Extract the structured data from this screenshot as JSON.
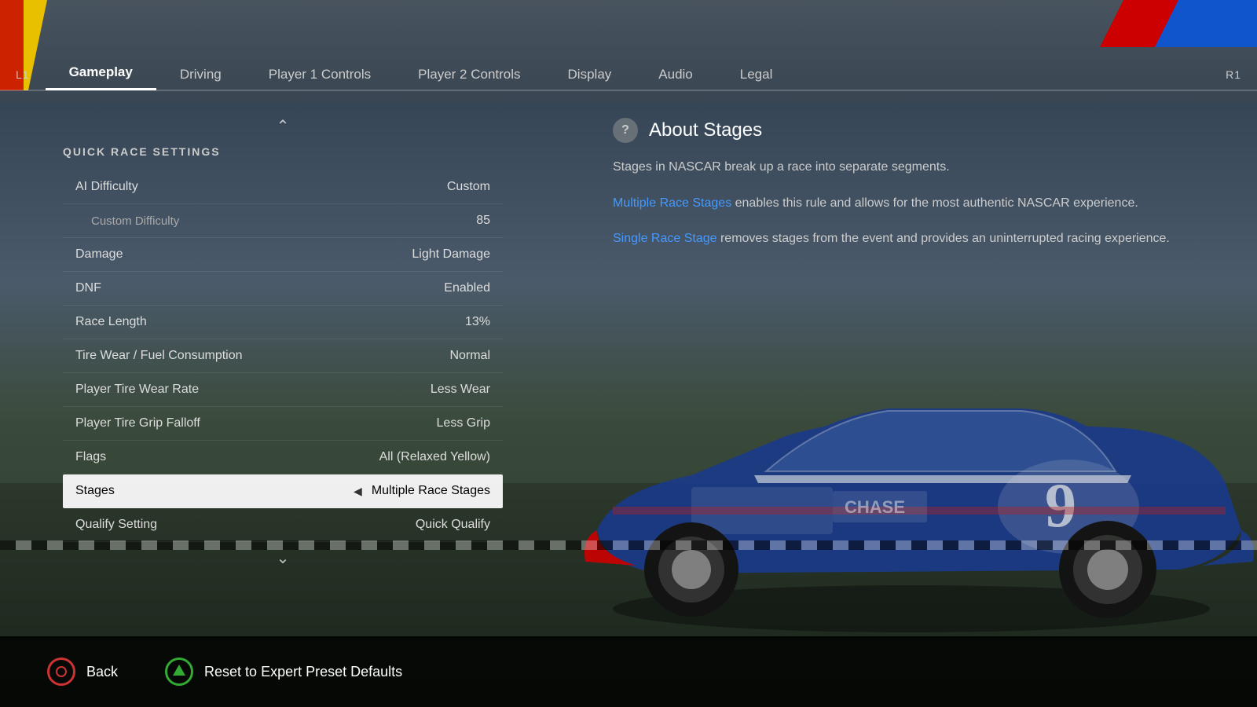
{
  "tabs": {
    "l1": "L1",
    "r1": "R1",
    "items": [
      {
        "label": "Gameplay",
        "active": true
      },
      {
        "label": "Driving",
        "active": false
      },
      {
        "label": "Player 1 Controls",
        "active": false
      },
      {
        "label": "Player 2 Controls",
        "active": false
      },
      {
        "label": "Display",
        "active": false
      },
      {
        "label": "Audio",
        "active": false
      },
      {
        "label": "Legal",
        "active": false
      }
    ]
  },
  "settings": {
    "section_title": "QUICK RACE SETTINGS",
    "rows": [
      {
        "name": "AI Difficulty",
        "value": "Custom",
        "indented": false,
        "active": false
      },
      {
        "name": "Custom Difficulty",
        "value": "85",
        "indented": true,
        "active": false
      },
      {
        "name": "Damage",
        "value": "Light Damage",
        "indented": false,
        "active": false
      },
      {
        "name": "DNF",
        "value": "Enabled",
        "indented": false,
        "active": false
      },
      {
        "name": "Race Length",
        "value": "13%",
        "indented": false,
        "active": false
      },
      {
        "name": "Tire Wear / Fuel Consumption",
        "value": "Normal",
        "indented": false,
        "active": false
      },
      {
        "name": "Player Tire Wear Rate",
        "value": "Less Wear",
        "indented": false,
        "active": false
      },
      {
        "name": "Player Tire Grip Falloff",
        "value": "Less Grip",
        "indented": false,
        "active": false
      },
      {
        "name": "Flags",
        "value": "All (Relaxed Yellow)",
        "indented": false,
        "active": false
      },
      {
        "name": "Stages",
        "value": "Multiple Race Stages",
        "indented": false,
        "active": true
      },
      {
        "name": "Qualify Setting",
        "value": "Quick Qualify",
        "indented": false,
        "active": false
      }
    ]
  },
  "info_panel": {
    "icon": "?",
    "title": "About Stages",
    "intro": "Stages in NASCAR break up a race into separate segments.",
    "link1_text": "Multiple Race Stages",
    "link1_desc": " enables this rule and allows for the most authentic NASCAR experience.",
    "link2_text": "Single Race Stage",
    "link2_desc": " removes stages from the event and provides an uninterrupted racing experience."
  },
  "bottom_bar": {
    "back_label": "Back",
    "reset_label": "Reset to Expert Preset Defaults"
  }
}
